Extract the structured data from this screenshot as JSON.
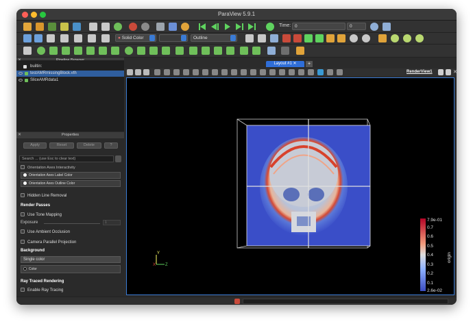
{
  "window": {
    "title": "ParaView 5.9.1"
  },
  "toolbar": {
    "time_label": "Time:",
    "time_value": "0",
    "color_by": "Solid Color",
    "representation": "Outline",
    "time_spin_value": "0"
  },
  "pipeline_browser": {
    "title": "Pipeline Browser",
    "items": [
      {
        "label": "builtin:"
      },
      {
        "label": "testAMRmissingBlock.vth"
      },
      {
        "label": "SliceAMRdata1"
      }
    ]
  },
  "layout": {
    "tab_label": "Layout #1",
    "add_tab": "+"
  },
  "render_view": {
    "label": "RenderView1"
  },
  "properties": {
    "title": "Properties",
    "apply": "Apply",
    "reset": "Reset",
    "delete": "Delete",
    "help": "?",
    "search_placeholder": "Search ... (use Esc to clear text)",
    "orientation_axes_interactivity": "Orientation Axes Interactivity",
    "orientation_axes_label_color": "Orientation Axes Label Color",
    "orientation_axes_outline_color": "Orientation Axes Outline Color",
    "hidden_line_removal": "Hidden Line Removal",
    "render_passes_title": "Render Passes",
    "use_tone_mapping": "Use Tone Mapping",
    "exposure": "Exposure",
    "exposure_value": "1",
    "use_ambient_occlusion": "Use Ambient Occlusion",
    "camera_parallel_projection": "Camera Parallel Projection",
    "background_title": "Background",
    "background_mode": "Single color",
    "color_label": "Color",
    "ray_traced_title": "Ray Traced Rendering",
    "enable_ray_tracing": "Enable Ray Tracing"
  },
  "color_legend": {
    "title": "origin",
    "max_label": "7.9e-01",
    "min_label": "2.6e-02",
    "ticks": [
      "0.7",
      "0.6",
      "0.5",
      "0.4",
      "0.3",
      "0.2",
      "0.1"
    ]
  },
  "axes": {
    "x": "X",
    "y": "Y",
    "z": "Z"
  }
}
